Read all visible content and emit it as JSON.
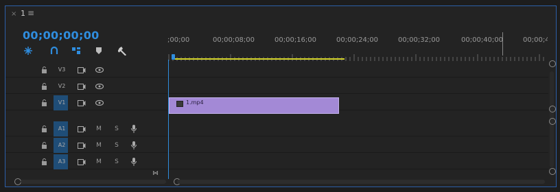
{
  "tab": {
    "close": "×",
    "title": "1",
    "menu": "≡"
  },
  "timecode": "00;00;00;00",
  "toolbar": {
    "icons": [
      "snap-icon",
      "linked-selection-icon",
      "add-marker-icon",
      "marker-icon",
      "wrench-icon"
    ]
  },
  "ruler": {
    "labels": [
      ";00;00",
      "00;00;08;00",
      "00;00;16;00",
      "00;00;24;00",
      "00;00;32;00",
      "00;00;40;00",
      "00;00;4"
    ]
  },
  "tracks": {
    "video": [
      {
        "name": "V3"
      },
      {
        "name": "V2"
      },
      {
        "name": "V1"
      }
    ],
    "audio": [
      {
        "name": "A1",
        "mute": "M",
        "solo": "S"
      },
      {
        "name": "A2",
        "mute": "M",
        "solo": "S"
      },
      {
        "name": "A3",
        "mute": "M",
        "solo": "S"
      }
    ]
  },
  "clip": {
    "name": "1.mp4",
    "track": "V1"
  },
  "colors": {
    "accent": "#2f8dde",
    "clip": "#a389d6",
    "work_area": "#d4d42a",
    "panel_border": "#2c5fa8",
    "track_target": "#1f4d77"
  }
}
